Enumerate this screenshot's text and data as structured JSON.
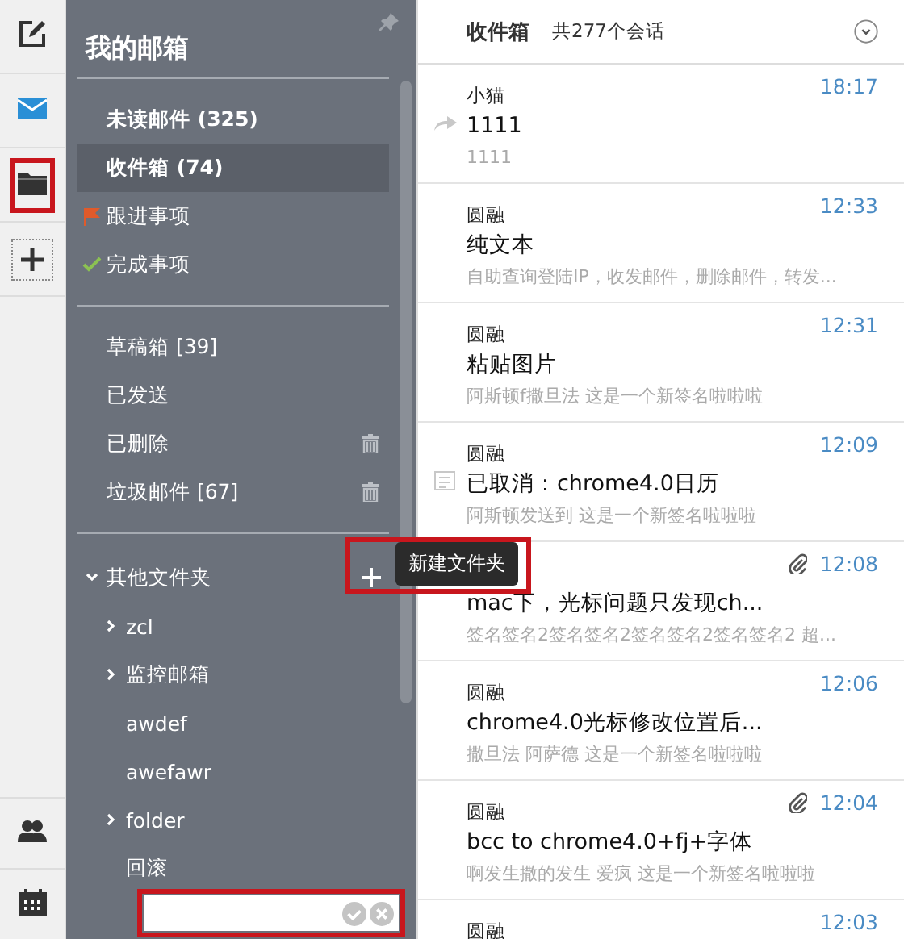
{
  "rail": {
    "top": [
      {
        "kind": "compose",
        "highlighted": false
      },
      {
        "kind": "mail",
        "highlighted": false
      },
      {
        "kind": "folder",
        "highlighted": true
      },
      {
        "kind": "add",
        "highlighted": false
      }
    ],
    "bottom": [
      {
        "kind": "contacts",
        "highlighted": false
      },
      {
        "kind": "calendar",
        "highlighted": false
      }
    ]
  },
  "sidebar": {
    "title": "我的邮箱",
    "groups": [
      {
        "items": [
          {
            "label": "未读邮件 (325)",
            "bold": true,
            "selected": false,
            "kind": "plain",
            "trash": false
          },
          {
            "label": "收件箱 (74)",
            "bold": true,
            "selected": true,
            "kind": "plain",
            "trash": false
          },
          {
            "label": "跟进事项",
            "bold": false,
            "selected": false,
            "kind": "flag",
            "trash": false
          },
          {
            "label": "完成事项",
            "bold": false,
            "selected": false,
            "kind": "done",
            "trash": false
          }
        ]
      },
      {
        "items": [
          {
            "label": "草稿箱 [39]",
            "bold": false,
            "selected": false,
            "kind": "plain",
            "trash": false
          },
          {
            "label": "已发送",
            "bold": false,
            "selected": false,
            "kind": "plain",
            "trash": false
          },
          {
            "label": "已删除",
            "bold": false,
            "selected": false,
            "kind": "plain",
            "trash": true
          },
          {
            "label": "垃圾邮件 [67]",
            "bold": false,
            "selected": false,
            "kind": "plain",
            "trash": true
          }
        ]
      }
    ],
    "other_folders": {
      "label": "其他文件夹",
      "expanded": true,
      "highlighted": true,
      "tooltip": "新建文件夹",
      "children": [
        {
          "label": "zcl",
          "kind": "collapsed"
        },
        {
          "label": "监控邮箱",
          "kind": "collapsed"
        },
        {
          "label": "awdef",
          "kind": "leaf"
        },
        {
          "label": "awefawr",
          "kind": "leaf"
        },
        {
          "label": "folder",
          "kind": "collapsed"
        },
        {
          "label": "回滚",
          "kind": "leaf"
        }
      ]
    },
    "new_folder_field": {
      "highlighted": true
    }
  },
  "list": {
    "title": "收件箱",
    "count": "共277个会话",
    "messages": [
      {
        "sender": "小猫",
        "subject": "1111",
        "preview": "1111",
        "time": "18:17",
        "kind": "forwarded"
      },
      {
        "sender": "圆融",
        "subject": "纯文本",
        "preview": "自助查询登陆IP，收发邮件，删除邮件，转发...",
        "time": "12:33",
        "kind": "plain"
      },
      {
        "sender": "圆融",
        "subject": "粘贴图片",
        "preview": "阿斯顿f撒旦法 这是一个新签名啦啦啦",
        "time": "12:31",
        "kind": "plain"
      },
      {
        "sender": "圆融",
        "subject": "已取消：chrome4.0日历",
        "preview": "阿斯顿发送到 这是一个新签名啦啦啦",
        "time": "12:09",
        "kind": "invite"
      },
      {
        "subject": "mac下，光标问题只发现ch...",
        "preview": "签名签名2签名签名2签名签名2签名签名2 超...",
        "time": "12:08",
        "kind": "attachment"
      },
      {
        "sender": "圆融",
        "subject": "chrome4.0光标修改位置后...",
        "preview": "撒旦法 阿萨德 这是一个新签名啦啦啦",
        "time": "12:06",
        "kind": "plain"
      },
      {
        "sender": "圆融",
        "subject": "bcc to chrome4.0+fj+字体",
        "preview": "啊发生撒的发生 爱疯 这是一个新签名啦啦啦",
        "time": "12:04",
        "kind": "attachment"
      },
      {
        "sender": "圆融",
        "time": "12:03",
        "kind": "plain"
      }
    ]
  }
}
